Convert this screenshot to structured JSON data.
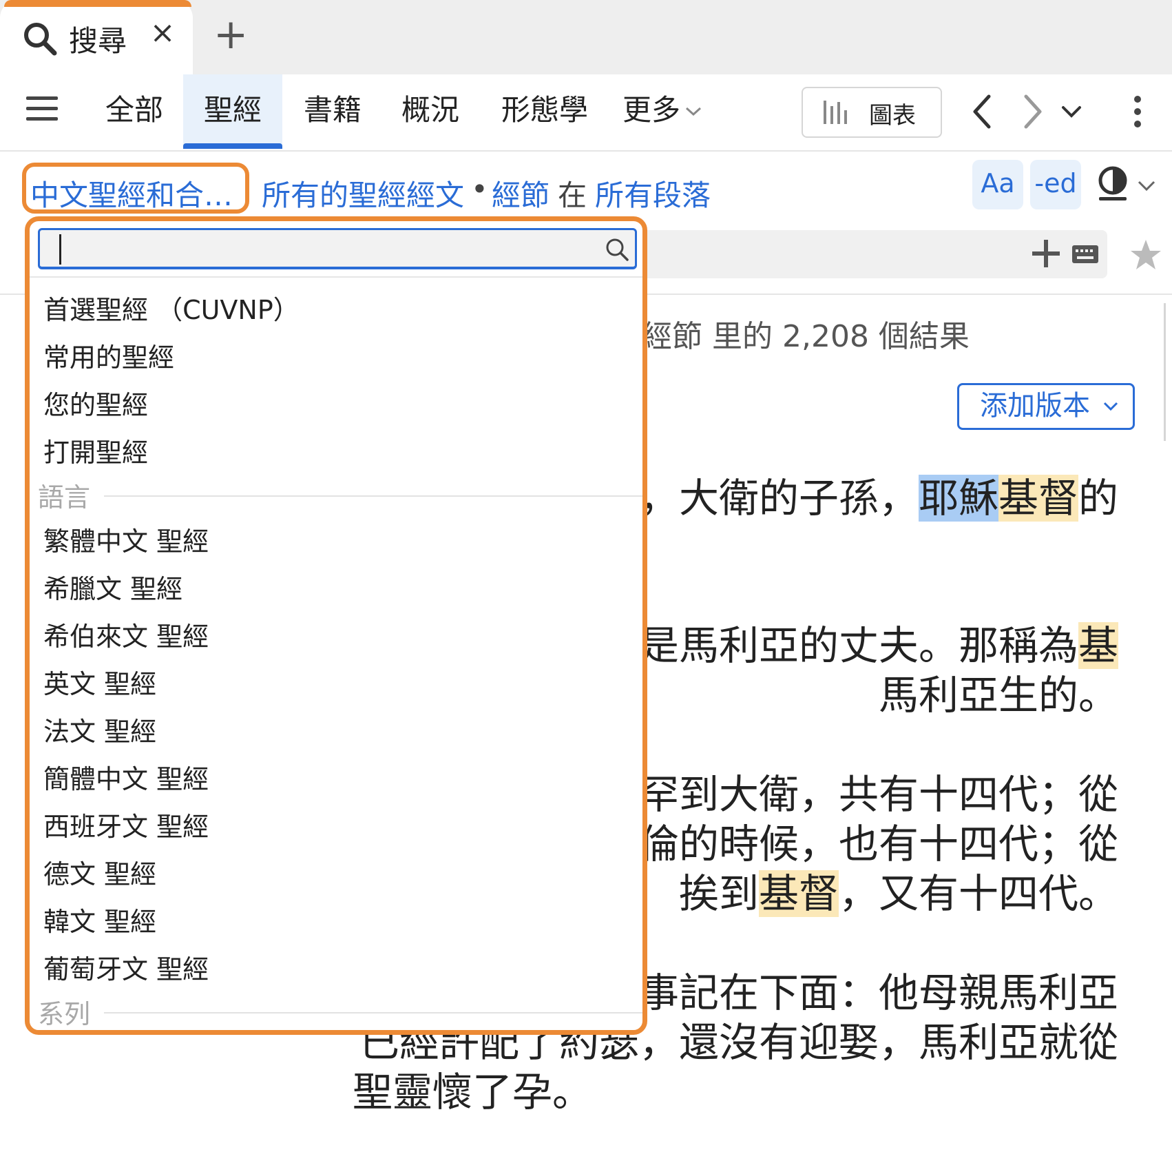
{
  "tab": {
    "title": "搜尋",
    "close_glyph": "×",
    "new_tab_glyph": "+"
  },
  "nav": {
    "tabs": [
      "全部",
      "聖經",
      "書籍",
      "概況",
      "形態學",
      "更多"
    ],
    "active_tab": "聖經",
    "chart_label": "圖表"
  },
  "filter": {
    "scope": "中文聖經和合…",
    "all_text": "所有的聖經經文",
    "separator": "•",
    "unit": "經節",
    "in_word": "在",
    "section": "所有段落"
  },
  "format_buttons": {
    "font": "Aa",
    "inflect": "-ed"
  },
  "results": {
    "count_text": "經節 里的 2,208 個結果",
    "add_version": "添加版本"
  },
  "verse_lines": [
    {
      "segments": [
        {
          "t": "，大衛的子孫，",
          "h": ""
        },
        {
          "t": "耶穌",
          "h": "blue"
        },
        {
          "t": "基督",
          "h": "yellow"
        },
        {
          "t": "的",
          "h": ""
        }
      ]
    },
    {
      "segments": [
        {
          "t": "是馬利亞的丈夫。那稱為",
          "h": ""
        },
        {
          "t": "基",
          "h": "yellow"
        }
      ]
    },
    {
      "segments": [
        {
          "t": "馬利亞生的。",
          "h": ""
        }
      ]
    },
    {
      "segments": [
        {
          "t": "罕到大衛，共有十四代；從",
          "h": ""
        }
      ]
    },
    {
      "segments": [
        {
          "t": "倫的時候，也有十四代；從",
          "h": ""
        }
      ]
    },
    {
      "segments": [
        {
          "t": "挨到",
          "h": ""
        },
        {
          "t": "基督",
          "h": "yellow"
        },
        {
          "t": "，又有十四代。",
          "h": ""
        }
      ]
    },
    {
      "segments": [
        {
          "t": "事記在下面：他母親馬利亞",
          "h": ""
        }
      ]
    },
    {
      "segments": [
        {
          "t": "已經許配了約瑟，還沒有迎娶，馬利亞就從",
          "h": ""
        }
      ]
    },
    {
      "segments": [
        {
          "t": "聖靈懷了孕。",
          "h": ""
        }
      ]
    }
  ],
  "dropdown": {
    "search_value": "",
    "top_items": [
      "首選聖經 （CUVNP）",
      "常用的聖經",
      "您的聖經",
      "打開聖經"
    ],
    "language_group": "語言",
    "language_items": [
      "繁體中文 聖經",
      "希臘文 聖經",
      "希伯來文 聖經",
      "英文 聖經",
      "法文 聖經",
      "簡體中文 聖經",
      "西班牙文 聖經",
      "德文 聖經",
      "韓文 聖經",
      "葡萄牙文 聖經"
    ],
    "series_group": "系列"
  },
  "icons": [
    "search-icon",
    "close-icon",
    "plus-icon",
    "menu-icon",
    "chevron-down-icon",
    "bar-chart-icon",
    "chevron-left-icon",
    "chevron-right-icon",
    "more-vertical-icon",
    "contrast-icon",
    "keyboard-icon",
    "star-icon"
  ],
  "colors": {
    "accent_orange": "#ec8a35",
    "link_blue": "#2a6cd6",
    "highlight_blue": "#a9ccf4",
    "highlight_yellow": "#fbe8b8"
  }
}
